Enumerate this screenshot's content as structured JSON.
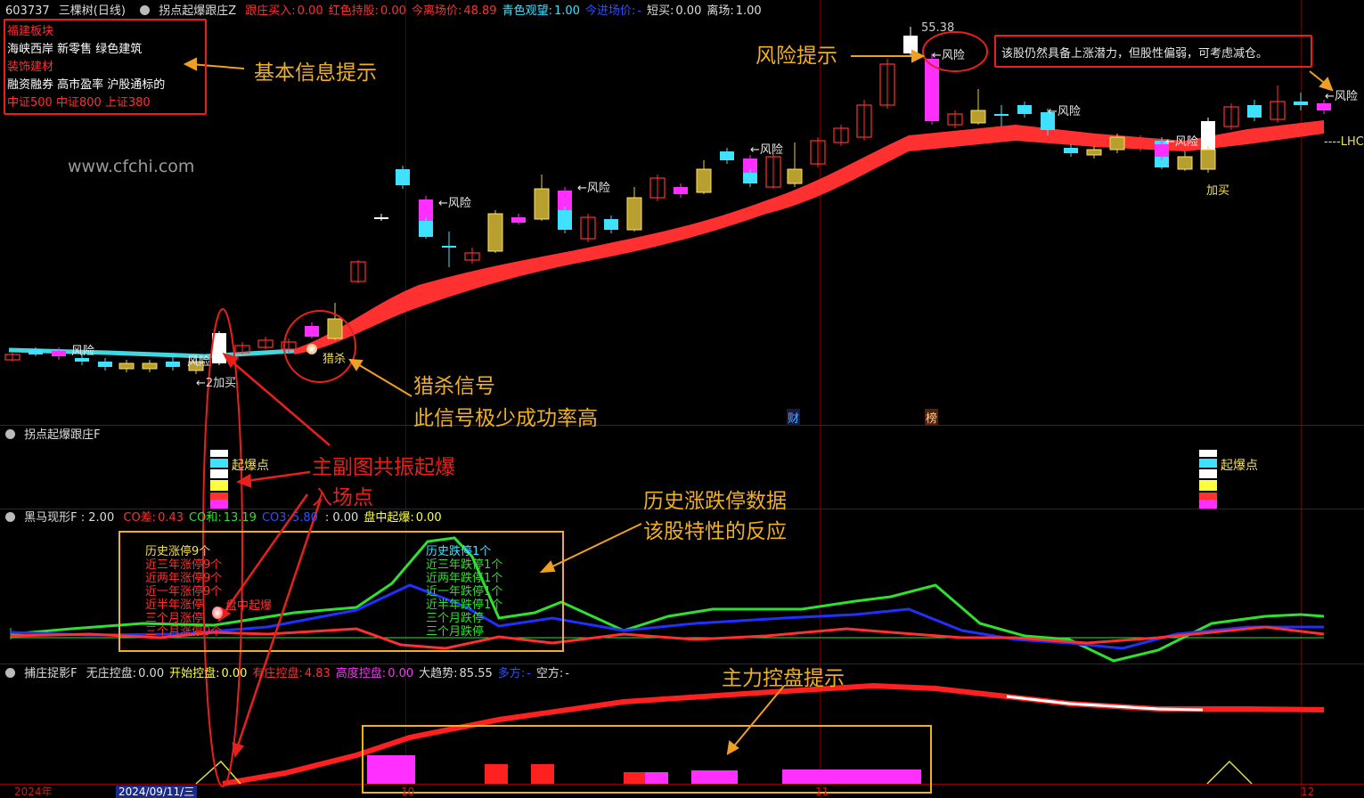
{
  "main_header": {
    "code": "603737",
    "name": "三棵树(日线)",
    "indicator": "拐点起爆跟庄Z",
    "items": [
      {
        "label": "跟庄买入:",
        "value": "0.00",
        "color": "#ff3030"
      },
      {
        "label": "红色持股:",
        "value": "0.00",
        "color": "#ff3030"
      },
      {
        "label": "今离场价:",
        "value": "48.89",
        "color": "#ff3030"
      },
      {
        "label": "青色观望:",
        "value": "1.00",
        "color": "#40e0ff"
      },
      {
        "label": "今进场价:",
        "value": "-",
        "color": "#3050ff"
      },
      {
        "label": "短买:",
        "value": "0.00",
        "color": "#dddddd"
      },
      {
        "label": "离场:",
        "value": "1.00",
        "color": "#dddddd"
      }
    ]
  },
  "info_box": {
    "lines": [
      {
        "text": "福建板块",
        "color": "#ff3030"
      },
      {
        "text": "海峡西岸 新零售 绿色建筑",
        "color": "#ffffff"
      },
      {
        "text": "装饰建材",
        "color": "#ff3030"
      },
      {
        "text": "融资融券 高市盈率 沪股通标的",
        "color": "#ffffff"
      },
      {
        "text": "中证500 中证800 上证380",
        "color": "#ff3030"
      }
    ]
  },
  "watermark": "www.cfchi.com",
  "annotations": {
    "basic_info": "基本信息提示",
    "risk_hint": "风险提示",
    "risk_text": "该股仍然具备上涨潜力，但股性偏弱，可考虑减仓。",
    "hunt_signal": "猎杀信号",
    "hunt_note": "此信号极少成功率高",
    "resonance_1": "主副图共振起爆",
    "resonance_2": "入场点",
    "history_1": "历史涨跌停数据",
    "history_2": "该股特性的反应",
    "control": "主力控盘提示"
  },
  "chart_marks": {
    "high_price": "55.38",
    "risk_label": "←风险",
    "risk_plain": "风险",
    "hunt": "猎杀",
    "add_buy": "加买",
    "add_buy_arrow": "←2加买",
    "lhc": "----LHC",
    "cai": "财",
    "bang": "榜",
    "explode": "起爆点"
  },
  "pane2": {
    "title": "拐点起爆跟庄F"
  },
  "pane3": {
    "title": "黑马现形F",
    "title_value": ": 2.00",
    "items": [
      {
        "label": "CO差:",
        "value": "0.43",
        "color": "#ff3030"
      },
      {
        "label": "CO和:",
        "value": "13.19",
        "color": "#30e030"
      },
      {
        "label": "CO3:",
        "value": "5.80",
        "color": "#3050ff"
      },
      {
        "label": "",
        "value": ": 0.00",
        "color": "#dddddd"
      },
      {
        "label": "盘中起爆:",
        "value": "0.00",
        "color": "#ffff40"
      }
    ],
    "limit_up": {
      "title": "历史涨停9个",
      "lines": [
        "近三年涨停9个",
        "近两年涨停9个",
        "近一年涨停9个",
        "近半年涨停",
        "三个月涨停",
        "三个月涨停0个"
      ],
      "midday": "盘中起爆"
    },
    "limit_down": {
      "title": "历史跌停1个",
      "lines": [
        "近三年跌停1个",
        "近两年跌停1个",
        "近一年跌停1个",
        "近半年跌停1个",
        "三个月跌停",
        "三个月跌停"
      ]
    }
  },
  "pane4": {
    "title": "捕庄捉影F",
    "items": [
      {
        "label": "无庄控盘:",
        "value": "0.00",
        "color": "#dddddd"
      },
      {
        "label": "开始控盘:",
        "value": "0.00",
        "color": "#ffff40"
      },
      {
        "label": "有庄控盘:",
        "value": "4.83",
        "color": "#ff3030"
      },
      {
        "label": "高度控盘:",
        "value": "0.00",
        "color": "#ff30ff"
      },
      {
        "label": "大趋势:",
        "value": "85.55",
        "color": "#dddddd"
      },
      {
        "label": "多方:",
        "value": "-",
        "color": "#3050ff"
      },
      {
        "label": "空方:",
        "value": "-",
        "color": "#dddddd"
      }
    ]
  },
  "date_axis": {
    "year": "2024年",
    "current": "2024/09/11/三",
    "m1": "10",
    "m2": "11",
    "m3": "12"
  }
}
